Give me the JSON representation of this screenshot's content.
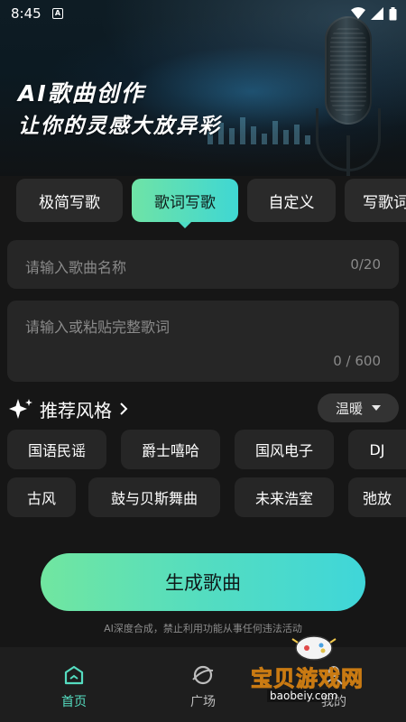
{
  "status_bar": {
    "time": "8:45",
    "notif_icon": "a-badge-icon"
  },
  "hero": {
    "title": "AI歌曲创作",
    "subtitle": "让你的灵感大放异彩"
  },
  "mode_tabs": [
    {
      "label": "极简写歌",
      "active": false
    },
    {
      "label": "歌词写歌",
      "active": true
    },
    {
      "label": "自定义",
      "active": false
    },
    {
      "label": "写歌词",
      "active": false
    }
  ],
  "song_name_input": {
    "placeholder": "请输入歌曲名称",
    "counter": "0/20"
  },
  "lyrics_input": {
    "placeholder": "请输入或粘贴完整歌词",
    "counter": "0 / 600"
  },
  "style_section": {
    "title": "推荐风格",
    "mood": "温暖",
    "chips_row1": [
      "国语民谣",
      "爵士嘻哈",
      "国风电子",
      "DJ"
    ],
    "chips_row2": [
      "古风",
      "鼓与贝斯舞曲",
      "未来浩室",
      "弛放"
    ]
  },
  "generate_button": "生成歌曲",
  "disclaimer": "AI深度合成，禁止利用功能从事任何违法活动",
  "bottom_nav": [
    {
      "label": "首页",
      "icon": "home-icon",
      "active": true
    },
    {
      "label": "广场",
      "icon": "plaza-icon",
      "active": false
    },
    {
      "label": "我的",
      "icon": "profile-icon",
      "active": false
    }
  ],
  "watermark": {
    "text": "宝贝游戏网",
    "url": "baobeiy.com"
  },
  "colors": {
    "accent_start": "#6fe3a6",
    "accent_end": "#3fd7d3",
    "background": "#161616",
    "card": "#262626"
  }
}
